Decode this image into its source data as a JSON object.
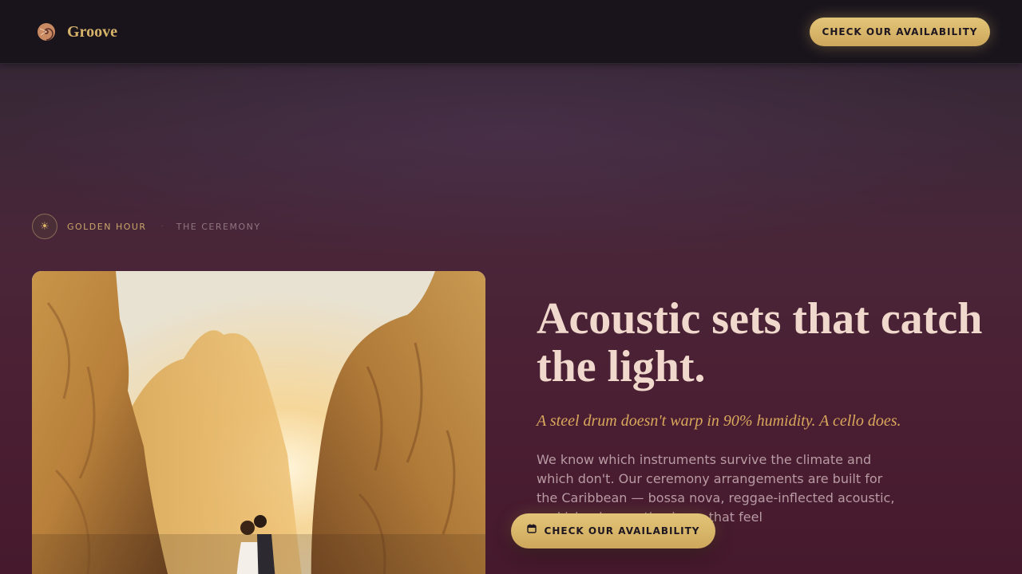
{
  "header": {
    "logo_icon": "spiral-shell-icon",
    "brand": "Groove",
    "cta_label": "CHECK OUR AVAILABILITY"
  },
  "breadcrumb": {
    "icon": "sun-icon",
    "active": "GOLDEN HOUR",
    "separator": "·",
    "next": "THE CEREMONY"
  },
  "hero": {
    "photo": "couple-between-sunlit-rocks-image",
    "headline": "Acoustic sets that catch the light.",
    "tagline": "A steel drum doesn't warp in 90% humidity. A cello does.",
    "body": "We know which instruments survive the climate and which don't. Our ceremony arrangements are built for the Caribbean — bossa nova, reggae-inflected acoustic, and island acoustic pieces that feel"
  },
  "floating_cta": {
    "icon": "calendar-icon",
    "label": "CHECK OUR AVAILABILITY"
  },
  "colors": {
    "accent_gold": "#d6b36a",
    "headline": "#f0d9cc",
    "tagline": "#d9a85c",
    "body": "#b89ba3",
    "topbar": "#19141c"
  }
}
